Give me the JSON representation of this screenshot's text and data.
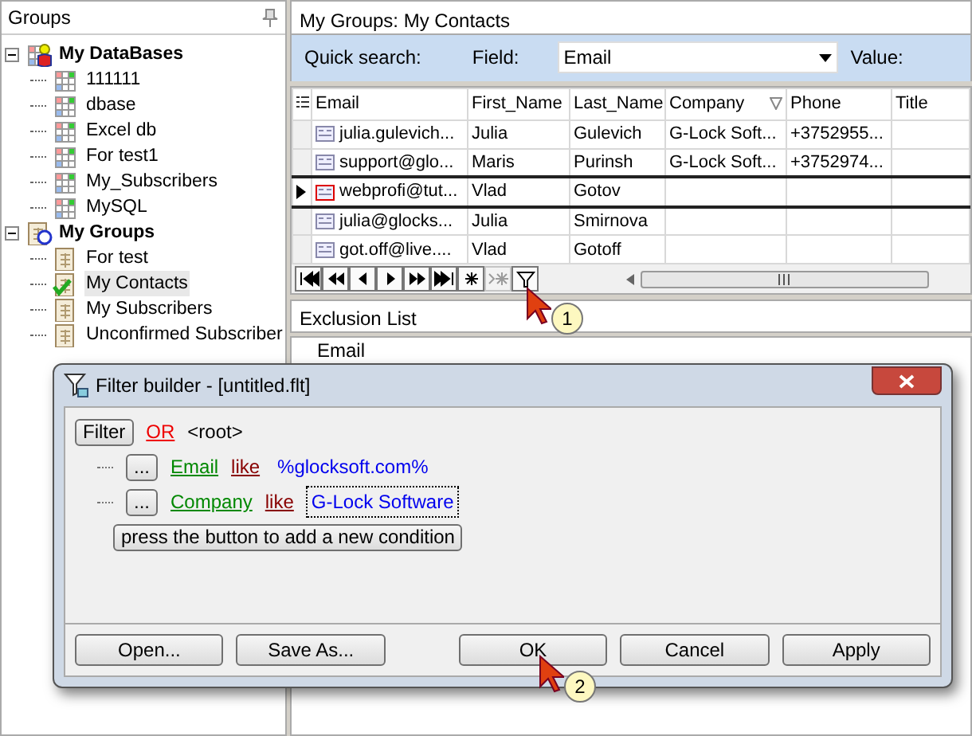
{
  "groups_panel": {
    "title": "Groups",
    "tree": [
      {
        "label": "My DataBases",
        "kind": "databases",
        "expanded": true,
        "selected": false,
        "children": [
          {
            "label": "111111",
            "kind": "table",
            "selected": false
          },
          {
            "label": "dbase",
            "kind": "table",
            "selected": false
          },
          {
            "label": "Excel db",
            "kind": "table",
            "selected": false
          },
          {
            "label": "For test1",
            "kind": "table",
            "selected": false
          },
          {
            "label": "My_Subscribers",
            "kind": "table",
            "selected": false
          },
          {
            "label": "MySQL",
            "kind": "table",
            "selected": false
          }
        ]
      },
      {
        "label": "My Groups",
        "kind": "groups",
        "expanded": true,
        "selected": false,
        "children": [
          {
            "label": "For test",
            "kind": "group",
            "selected": false
          },
          {
            "label": "My Contacts",
            "kind": "group_checked",
            "selected": true
          },
          {
            "label": "My Subscribers",
            "kind": "group",
            "selected": false
          },
          {
            "label": "Unconfirmed Subscriber",
            "kind": "group",
            "selected": false
          }
        ]
      }
    ]
  },
  "contacts_panel": {
    "title": "My Groups: My Contacts",
    "quick_search": {
      "label": "Quick search:",
      "field_label": "Field:",
      "field_value": "Email",
      "value_label": "Value:"
    },
    "columns": [
      {
        "label": "Email",
        "filtered": false
      },
      {
        "label": "First_Name",
        "filtered": false
      },
      {
        "label": "Last_Name",
        "filtered": false
      },
      {
        "label": "Company",
        "filtered": true
      },
      {
        "label": "Phone",
        "filtered": false
      },
      {
        "label": "Title",
        "filtered": false
      }
    ],
    "rows": [
      {
        "selected": false,
        "cells": [
          "julia.gulevich...",
          "Julia",
          "Gulevich",
          "G-Lock Soft...",
          "+3752955...",
          ""
        ]
      },
      {
        "selected": false,
        "cells": [
          "support@glo...",
          "Maris",
          "Purinsh",
          "G-Lock Soft...",
          "+3752974...",
          ""
        ]
      },
      {
        "selected": true,
        "cells": [
          "webprofi@tut...",
          "Vlad",
          "Gotov",
          "",
          "",
          ""
        ]
      },
      {
        "selected": false,
        "cells": [
          "julia@glocks...",
          "Julia",
          "Smirnova",
          "",
          "",
          ""
        ]
      },
      {
        "selected": false,
        "cells": [
          "got.off@live....",
          "Vlad",
          "Gotoff",
          "",
          "",
          ""
        ]
      }
    ],
    "navigator": [
      {
        "kind": "first",
        "disabled": false
      },
      {
        "kind": "prior_page",
        "disabled": false
      },
      {
        "kind": "prior",
        "disabled": false
      },
      {
        "kind": "next",
        "disabled": false
      },
      {
        "kind": "next_page",
        "disabled": false
      },
      {
        "kind": "last",
        "disabled": false
      },
      {
        "kind": "insert",
        "disabled": false
      },
      {
        "kind": "post",
        "disabled": true
      },
      {
        "kind": "filter",
        "disabled": false
      }
    ]
  },
  "exclusion_panel": {
    "title": "Exclusion List",
    "columns": [
      "Email"
    ]
  },
  "callouts": [
    "1",
    "2"
  ],
  "filter_dialog": {
    "title": "Filter builder - [untitled.flt]",
    "filter_button": "Filter",
    "group_operator": "OR",
    "root_label": "<root>",
    "conditions": [
      {
        "button": "...",
        "field": "Email",
        "operator": "like",
        "value": "%glocksoft.com%",
        "focused": false
      },
      {
        "button": "...",
        "field": "Company",
        "operator": "like",
        "value": "G-Lock Software",
        "focused": true
      }
    ],
    "add_button": "press the button to add a new condition",
    "buttons": [
      "Open...",
      "Save As...",
      "OK",
      "Cancel",
      "Apply"
    ]
  }
}
